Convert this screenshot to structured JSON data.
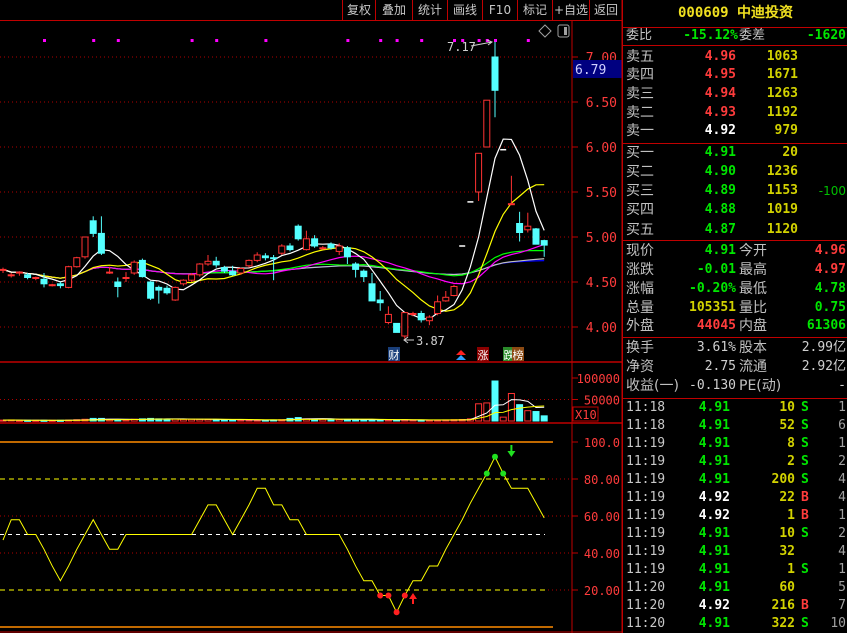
{
  "toolbar": {
    "buttons": [
      "复权",
      "叠加",
      "统计",
      "画线",
      "F10",
      "标记",
      "+自选",
      "返回"
    ]
  },
  "stock": {
    "code": "000609",
    "name": "中迪投资",
    "title": "000609 中迪投资"
  },
  "order_book": {
    "weibi_label": "委比",
    "weibi": "-15.12%",
    "weicha_label": "委差",
    "weicha": "-1620",
    "sell": [
      {
        "label": "卖五",
        "price": "4.96",
        "vol": "1063",
        "change": ""
      },
      {
        "label": "卖四",
        "price": "4.95",
        "vol": "1671",
        "change": ""
      },
      {
        "label": "卖三",
        "price": "4.94",
        "vol": "1263",
        "change": ""
      },
      {
        "label": "卖二",
        "price": "4.93",
        "vol": "1192",
        "change": ""
      },
      {
        "label": "卖一",
        "price": "4.92",
        "vol": "979",
        "change": ""
      }
    ],
    "buy": [
      {
        "label": "买一",
        "price": "4.91",
        "vol": "20",
        "change": ""
      },
      {
        "label": "买二",
        "price": "4.90",
        "vol": "1236",
        "change": ""
      },
      {
        "label": "买三",
        "price": "4.89",
        "vol": "1153",
        "change": "-100"
      },
      {
        "label": "买四",
        "price": "4.88",
        "vol": "1019",
        "change": ""
      },
      {
        "label": "买五",
        "price": "4.87",
        "vol": "1120",
        "change": ""
      }
    ]
  },
  "stats": [
    {
      "l1": "现价",
      "v1": "4.91",
      "c1": "#00e600",
      "l2": "今开",
      "v2": "4.96",
      "c2": "#ff3c3c"
    },
    {
      "l1": "涨跌",
      "v1": "-0.01",
      "c1": "#00e600",
      "l2": "最高",
      "v2": "4.97",
      "c2": "#ff3c3c"
    },
    {
      "l1": "涨幅",
      "v1": "-0.20%",
      "c1": "#00e600",
      "l2": "最低",
      "v2": "4.78",
      "c2": "#00e600"
    },
    {
      "l1": "总量",
      "v1": "105351",
      "c1": "#d2d200",
      "l2": "量比",
      "v2": "0.75",
      "c2": "#00e600"
    },
    {
      "l1": "外盘",
      "v1": "44045",
      "c1": "#ff3c3c",
      "l2": "内盘",
      "v2": "61306",
      "c2": "#00e600"
    }
  ],
  "stats2": [
    {
      "l1": "换手",
      "v1": "3.61%",
      "l2": "股本",
      "v2": "2.99亿"
    },
    {
      "l1": "净资",
      "v1": "2.75",
      "l2": "流通",
      "v2": "2.92亿"
    },
    {
      "l1": "收益(一)",
      "v1": "-0.130",
      "l2": "PE(动)",
      "v2": "-"
    }
  ],
  "ticks": [
    {
      "time": "11:18",
      "price": "4.91",
      "vol": "10",
      "side": "S",
      "count": "1"
    },
    {
      "time": "11:18",
      "price": "4.91",
      "vol": "52",
      "side": "S",
      "count": "6"
    },
    {
      "time": "11:19",
      "price": "4.91",
      "vol": "8",
      "side": "S",
      "count": "1"
    },
    {
      "time": "11:19",
      "price": "4.91",
      "vol": "2",
      "side": "S",
      "count": "2"
    },
    {
      "time": "11:19",
      "price": "4.91",
      "vol": "200",
      "side": "S",
      "count": "4"
    },
    {
      "time": "11:19",
      "price": "4.92",
      "vol": "22",
      "side": "B",
      "count": "4"
    },
    {
      "time": "11:19",
      "price": "4.92",
      "vol": "1",
      "side": "B",
      "count": "1"
    },
    {
      "time": "11:19",
      "price": "4.91",
      "vol": "10",
      "side": "S",
      "count": "2"
    },
    {
      "time": "11:19",
      "price": "4.91",
      "vol": "32",
      "side": "",
      "count": "4"
    },
    {
      "time": "11:19",
      "price": "4.91",
      "vol": "1",
      "side": "S",
      "count": "1"
    },
    {
      "time": "11:20",
      "price": "4.91",
      "vol": "60",
      "side": "",
      "count": "5"
    },
    {
      "time": "11:20",
      "price": "4.92",
      "vol": "216",
      "side": "B",
      "count": "7"
    },
    {
      "time": "11:20",
      "price": "4.91",
      "vol": "322",
      "side": "S",
      "count": "10"
    }
  ],
  "chart": {
    "price_axis": [
      "7.00",
      "6.50",
      "6.00",
      "5.50",
      "5.00",
      "4.50",
      "4.00"
    ],
    "cursor_price": "6.79",
    "high_label": "7.17",
    "low_label": "3.87",
    "volume_axis": [
      "100000",
      "50000"
    ],
    "volume_unit": "X10",
    "osc_axis": [
      "100.0",
      "80.00",
      "60.00",
      "40.00",
      "20.00"
    ],
    "events": [
      "财",
      "涨",
      "跌",
      "榜"
    ],
    "colors": {
      "up": "#ff3232",
      "down": "#54ffff",
      "ma5": "#ffffff",
      "ma10": "#ffff00",
      "ma20": "#ff00ff",
      "ma30": "#00ff00",
      "ma60": "#c0c0c0",
      "ma120": "#0000ff",
      "osc": "#ffff00"
    },
    "top_marker_candles": [
      5,
      11,
      14,
      23,
      26,
      32,
      42,
      46,
      48,
      51,
      55,
      56,
      58,
      59,
      60,
      64
    ],
    "candles": [
      [
        4.63,
        4.66,
        4.6,
        4.64
      ],
      [
        4.58,
        4.6,
        4.55,
        4.58
      ],
      [
        4.6,
        4.62,
        4.57,
        4.61
      ],
      [
        4.58,
        4.6,
        4.53,
        4.55
      ],
      [
        4.54,
        4.56,
        4.52,
        4.55
      ],
      [
        4.53,
        4.6,
        4.44,
        4.48
      ],
      [
        4.46,
        4.48,
        4.45,
        4.47
      ],
      [
        4.48,
        4.5,
        4.43,
        4.46
      ],
      [
        4.44,
        4.68,
        4.43,
        4.67
      ],
      [
        4.67,
        4.78,
        4.66,
        4.77
      ],
      [
        4.78,
        5.0,
        4.76,
        5.0
      ],
      [
        5.18,
        5.23,
        5.0,
        5.04
      ],
      [
        5.04,
        5.23,
        4.8,
        4.82
      ],
      [
        4.6,
        4.67,
        4.59,
        4.61
      ],
      [
        4.5,
        4.55,
        4.33,
        4.45
      ],
      [
        4.55,
        4.61,
        4.5,
        4.55
      ],
      [
        4.6,
        4.74,
        4.58,
        4.72
      ],
      [
        4.74,
        4.76,
        4.55,
        4.56
      ],
      [
        4.5,
        4.51,
        4.3,
        4.32
      ],
      [
        4.44,
        4.46,
        4.26,
        4.41
      ],
      [
        4.43,
        4.46,
        4.36,
        4.38
      ],
      [
        4.3,
        4.45,
        4.29,
        4.44
      ],
      [
        4.48,
        4.53,
        4.46,
        4.52
      ],
      [
        4.52,
        4.6,
        4.5,
        4.58
      ],
      [
        4.58,
        4.71,
        4.56,
        4.7
      ],
      [
        4.7,
        4.8,
        4.68,
        4.73
      ],
      [
        4.73,
        4.78,
        4.66,
        4.69
      ],
      [
        4.66,
        4.68,
        4.6,
        4.62
      ],
      [
        4.62,
        4.68,
        4.57,
        4.58
      ],
      [
        4.6,
        4.66,
        4.58,
        4.65
      ],
      [
        4.68,
        4.75,
        4.66,
        4.74
      ],
      [
        4.74,
        4.83,
        4.72,
        4.8
      ],
      [
        4.79,
        4.82,
        4.74,
        4.77
      ],
      [
        4.77,
        4.8,
        4.52,
        4.76
      ],
      [
        4.82,
        4.92,
        4.8,
        4.9
      ],
      [
        4.9,
        4.93,
        4.84,
        4.86
      ],
      [
        5.12,
        5.14,
        4.96,
        4.98
      ],
      [
        4.86,
        5.07,
        4.85,
        4.98
      ],
      [
        4.98,
        5.02,
        4.88,
        4.9
      ],
      [
        4.87,
        4.9,
        4.86,
        4.88
      ],
      [
        4.92,
        4.94,
        4.86,
        4.88
      ],
      [
        4.84,
        4.93,
        4.8,
        4.9
      ],
      [
        4.88,
        4.9,
        4.7,
        4.78
      ],
      [
        4.7,
        4.72,
        4.55,
        4.64
      ],
      [
        4.62,
        4.64,
        4.5,
        4.56
      ],
      [
        4.48,
        4.6,
        4.29,
        4.29
      ],
      [
        4.3,
        4.4,
        4.18,
        4.27
      ],
      [
        4.05,
        4.23,
        4.03,
        4.14
      ],
      [
        4.04,
        4.04,
        3.94,
        3.94
      ],
      [
        3.9,
        4.16,
        3.87,
        4.16
      ],
      [
        4.14,
        4.17,
        4.12,
        4.15
      ],
      [
        4.15,
        4.18,
        4.05,
        4.08
      ],
      [
        4.07,
        4.13,
        4.02,
        4.11
      ],
      [
        4.15,
        4.35,
        4.13,
        4.28
      ],
      [
        4.29,
        4.4,
        4.28,
        4.33
      ],
      [
        4.35,
        4.47,
        4.34,
        4.45
      ],
      [
        4.9,
        4.9,
        4.9,
        4.9
      ],
      [
        5.39,
        5.39,
        5.39,
        5.39
      ],
      [
        5.5,
        5.93,
        5.4,
        5.93
      ],
      [
        6.0,
        6.52,
        6.0,
        6.52
      ],
      [
        7.0,
        7.17,
        6.33,
        6.63
      ],
      [
        5.97,
        5.97,
        5.97,
        5.97
      ],
      [
        5.37,
        5.68,
        5.36,
        5.37
      ],
      [
        5.15,
        5.28,
        4.95,
        5.05
      ],
      [
        5.08,
        5.27,
        5.05,
        5.12
      ],
      [
        5.09,
        5.1,
        4.92,
        4.92
      ],
      [
        4.96,
        4.97,
        4.78,
        4.91
      ]
    ],
    "volumes": [
      2000,
      2500,
      1500,
      1500,
      1500,
      1500,
      1500,
      1500,
      2000,
      3000,
      4000,
      6000,
      6000,
      3000,
      3000,
      2500,
      4000,
      5000,
      6000,
      5000,
      4500,
      4500,
      4000,
      4000,
      4000,
      3500,
      3500,
      3000,
      3000,
      2500,
      2500,
      2000,
      2000,
      2500,
      3000,
      6000,
      8000,
      5000,
      4500,
      4000,
      4000,
      3500,
      3500,
      3500,
      3000,
      3500,
      3000,
      2500,
      2500,
      3000,
      2500,
      2000,
      2000,
      2000,
      2500,
      3000,
      3500,
      5000,
      40000,
      42000,
      93000,
      9000,
      64000,
      38000,
      24000,
      22000,
      12000
    ],
    "oscillator": [
      47,
      58,
      58,
      50,
      50,
      42,
      33,
      25,
      33,
      42,
      50,
      58,
      50,
      42,
      42,
      50,
      50,
      50,
      50,
      50,
      50,
      50,
      50,
      50,
      58,
      66,
      66,
      58,
      50,
      58,
      66,
      75,
      75,
      66,
      66,
      58,
      58,
      50,
      50,
      50,
      50,
      50,
      42,
      33,
      25,
      25,
      17,
      17,
      8,
      17,
      25,
      25,
      33,
      33,
      42,
      50,
      58,
      67,
      75,
      83,
      92,
      83,
      75,
      75,
      75,
      67,
      59
    ],
    "osc_buy_dots": [
      46,
      47,
      48,
      49
    ],
    "osc_sell_dots": [
      59,
      60,
      61
    ],
    "osc_buy_arrow": 50,
    "osc_sell_arrow": 62
  }
}
